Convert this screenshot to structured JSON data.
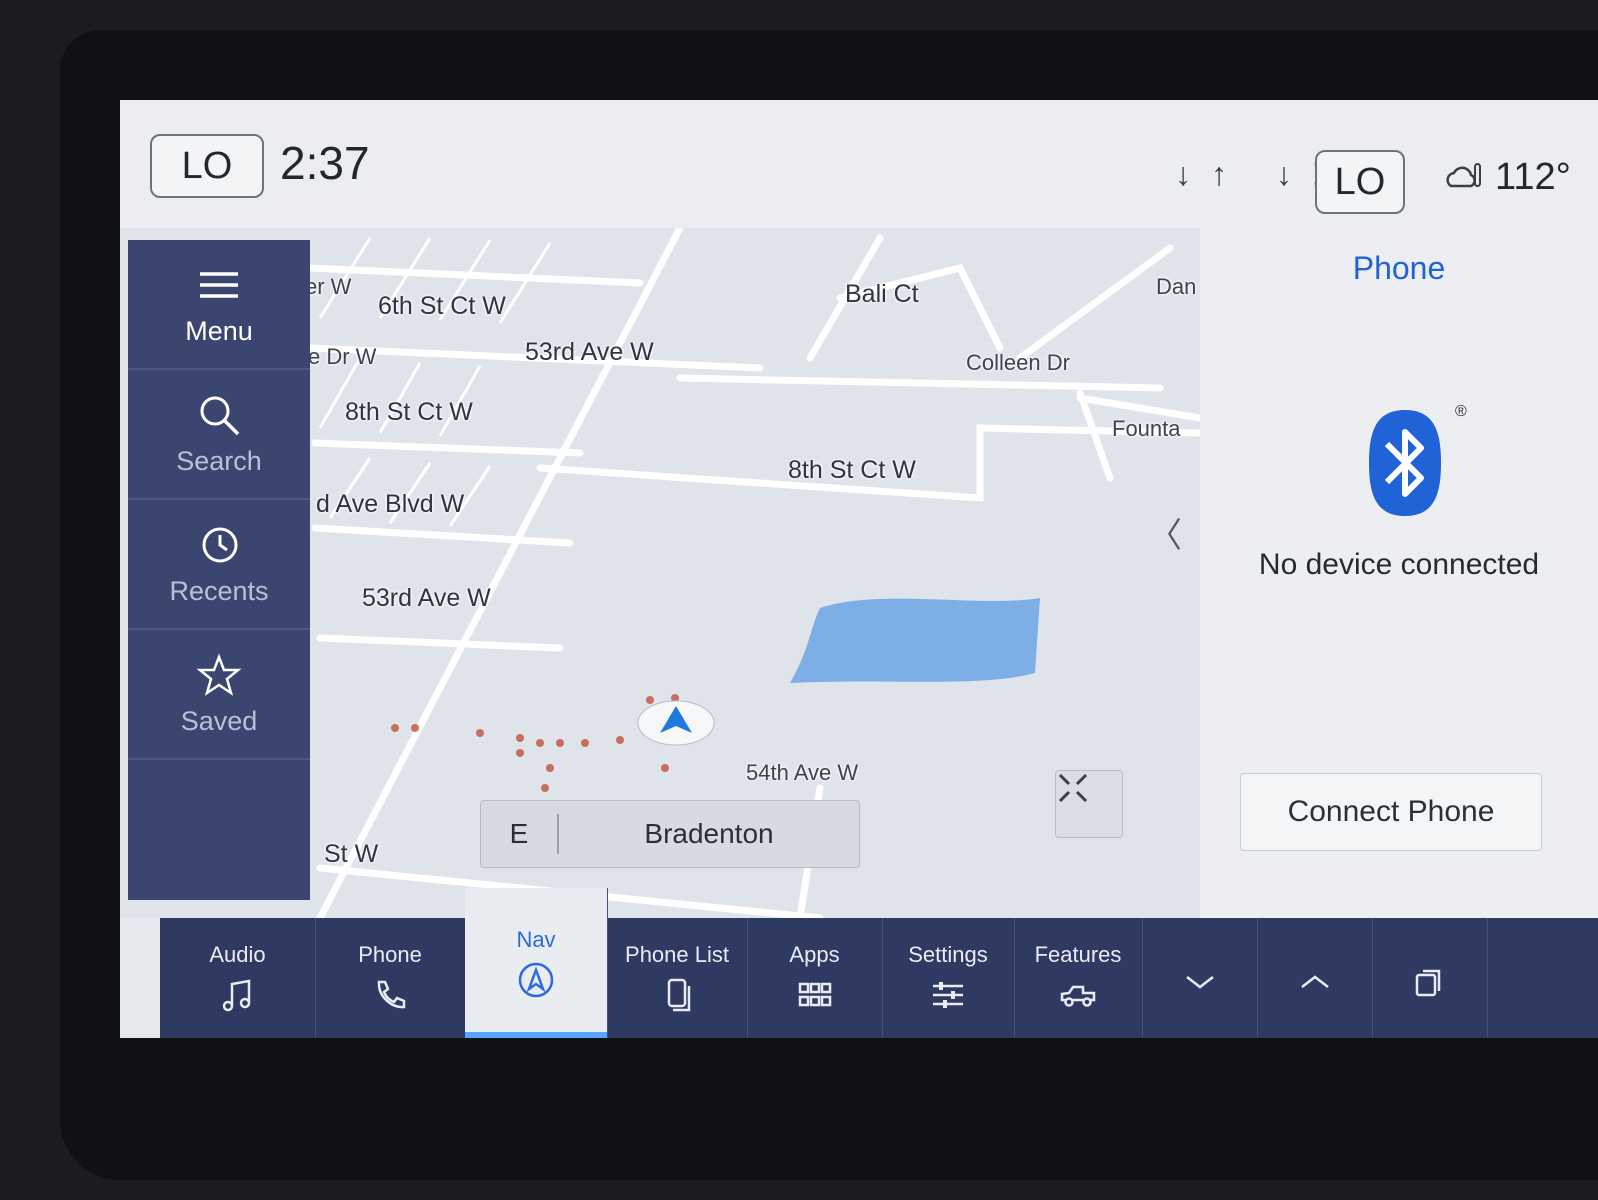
{
  "status": {
    "left_temp": "LO",
    "time": "2:37",
    "fan_icons": "↓↑ ↓!",
    "right_temp": "LO",
    "outside_temp": "112°",
    "weather_icon": "cloud-thermometer-icon"
  },
  "sidenav": {
    "items": [
      {
        "label": "Menu",
        "icon": "hamburger-icon"
      },
      {
        "label": "Search",
        "icon": "search-icon"
      },
      {
        "label": "Recents",
        "icon": "history-icon"
      },
      {
        "label": "Saved",
        "icon": "star-icon"
      }
    ]
  },
  "map": {
    "streets": [
      "er W",
      "6th St Ct W",
      "e Dr W",
      "53rd Ave W",
      "8th St Ct W",
      "d Ave Blvd W",
      "53rd Ave W",
      "Bali Ct",
      "Colleen Dr",
      "8th St Ct W",
      "Dan",
      "Founta",
      "54th Ave W",
      "St W"
    ],
    "heading": "E",
    "city": "Bradenton",
    "water_color": "#7eaee6",
    "breadcrumb_color": "#c25a47"
  },
  "phone": {
    "title": "Phone",
    "status": "No device connected",
    "registered_mark": "®",
    "connect_label": "Connect Phone",
    "accent": "#1f63d6"
  },
  "bottombar": {
    "tabs": [
      {
        "label": "Audio",
        "icon": "music-note-icon"
      },
      {
        "label": "Phone",
        "icon": "phone-icon"
      },
      {
        "label": "Nav",
        "icon": "nav-icon"
      },
      {
        "label": "Phone List",
        "icon": "phone-list-icon"
      },
      {
        "label": "Apps",
        "icon": "apps-grid-icon"
      },
      {
        "label": "Settings",
        "icon": "sliders-icon"
      },
      {
        "label": "Features",
        "icon": "truck-icon"
      }
    ]
  }
}
